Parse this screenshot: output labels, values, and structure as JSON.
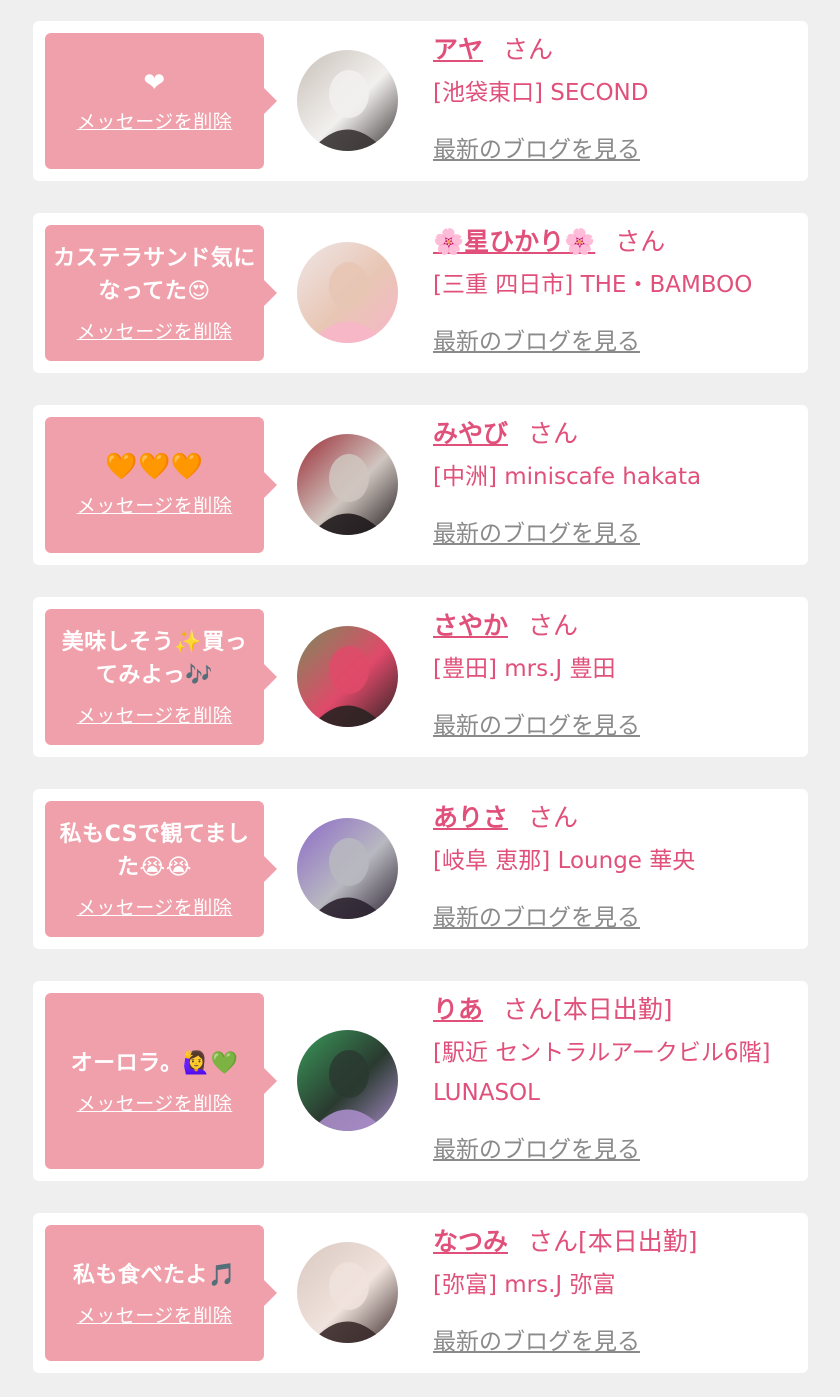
{
  "items": [
    {
      "message": "❤",
      "delete_label": "メッセージを削除",
      "name": "アヤ",
      "honorific": "さん",
      "shop": "[池袋東口] SECOND",
      "blog_label": "最新のブログを見る",
      "avatar_colors": [
        "#c8c0b8",
        "#3a3434",
        "#f2f0ee"
      ]
    },
    {
      "message": "カステラサンド気になってた😍",
      "delete_label": "メッセージを削除",
      "name": "🌸星ひかり🌸",
      "honorific": "さん",
      "shop": "[三重 四日市] THE・BAMBOO",
      "blog_label": "最新のブログを見る",
      "avatar_colors": [
        "#efe6e6",
        "#f7b6c8",
        "#e8c6b4"
      ]
    },
    {
      "message": "🧡🧡🧡",
      "delete_label": "メッセージを削除",
      "name": "みやび",
      "honorific": "さん",
      "shop": "[中洲] miniscafe hakata",
      "blog_label": "最新のブログを見る",
      "avatar_colors": [
        "#9a2a34",
        "#1f1a1c",
        "#d0c6c0"
      ]
    },
    {
      "message": "美味しそう✨買ってみよっ🎶",
      "delete_label": "メッセージを削除",
      "name": "さやか",
      "honorific": "さん",
      "shop": "[豊田] mrs.J 豊田",
      "blog_label": "最新のブログを見る",
      "avatar_colors": [
        "#7a8a5a",
        "#2a2222",
        "#e04a6a"
      ]
    },
    {
      "message": "私もCSで観てました😭😭",
      "delete_label": "メッセージを削除",
      "name": "ありさ",
      "honorific": "さん",
      "shop": "[岐阜 恵那] Lounge 華央",
      "blog_label": "最新のブログを見る",
      "avatar_colors": [
        "#8c6ac8",
        "#2c2230",
        "#b8b8c0"
      ]
    },
    {
      "message": "オーロラ。🙋‍♀️💚",
      "delete_label": "メッセージを削除",
      "name": "りあ",
      "honorific": "さん[本日出勤]",
      "shop": "[駅近 セントラルアークビル6階] LUNASOL",
      "blog_label": "最新のブログを見る",
      "avatar_colors": [
        "#3a9a5a",
        "#a88cc8",
        "#2a3a30"
      ]
    },
    {
      "message": "私も食べたよ🎵",
      "delete_label": "メッセージを削除",
      "name": "なつみ",
      "honorific": "さん[本日出勤]",
      "shop": "[弥富] mrs.J 弥富",
      "blog_label": "最新のブログを見る",
      "avatar_colors": [
        "#d8c8c0",
        "#3a2a2a",
        "#f0e2dc"
      ]
    }
  ]
}
